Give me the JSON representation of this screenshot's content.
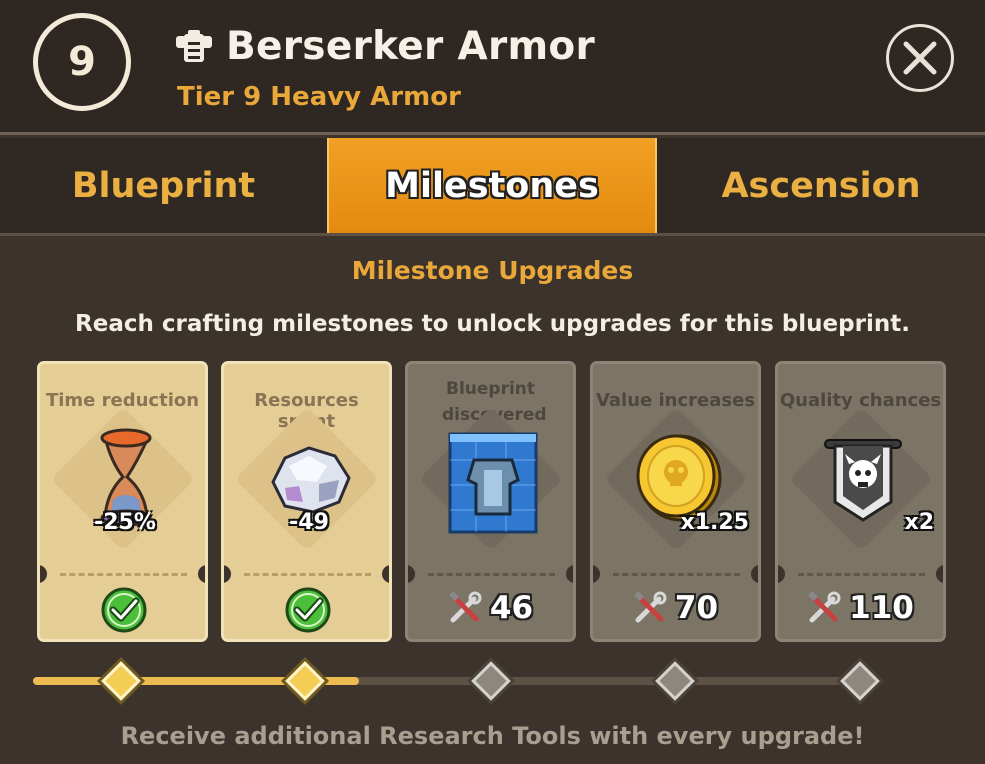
{
  "header": {
    "tier_number": "9",
    "title": "Berserker Armor",
    "subtitle": "Tier 9 Heavy Armor",
    "close_icon": "close-icon"
  },
  "tabs": [
    {
      "label": "Blueprint",
      "active": false
    },
    {
      "label": "Milestones",
      "active": true
    },
    {
      "label": "Ascension",
      "active": false
    }
  ],
  "section": {
    "title": "Milestone Upgrades",
    "description": "Reach crafting milestones to unlock upgrades for this blueprint."
  },
  "milestones": [
    {
      "label": "Time reduction",
      "icon": "hourglass-icon",
      "amount": "-25%",
      "status": "unlocked"
    },
    {
      "label": "Resources spent",
      "icon": "ore-icon",
      "amount": "-49",
      "status": "unlocked"
    },
    {
      "label": "Blueprint discovered",
      "icon": "blueprint-icon",
      "amount": "",
      "status": "locked",
      "cost": "46"
    },
    {
      "label": "Value increases",
      "icon": "coin-icon",
      "amount": "x1.25",
      "status": "locked",
      "cost": "70"
    },
    {
      "label": "Quality chances",
      "icon": "banner-icon",
      "amount": "x2",
      "status": "locked",
      "cost": "110"
    }
  ],
  "progress": {
    "milestones_reached": 2,
    "milestones_total": 5,
    "fill_fraction": 0.4
  },
  "footer": "Receive additional Research Tools with every upgrade!",
  "colors": {
    "accent": "#eaa83a",
    "active_tab": "#e8921a",
    "unlocked_card": "#e5cd96",
    "locked_card": "#7c7464"
  }
}
